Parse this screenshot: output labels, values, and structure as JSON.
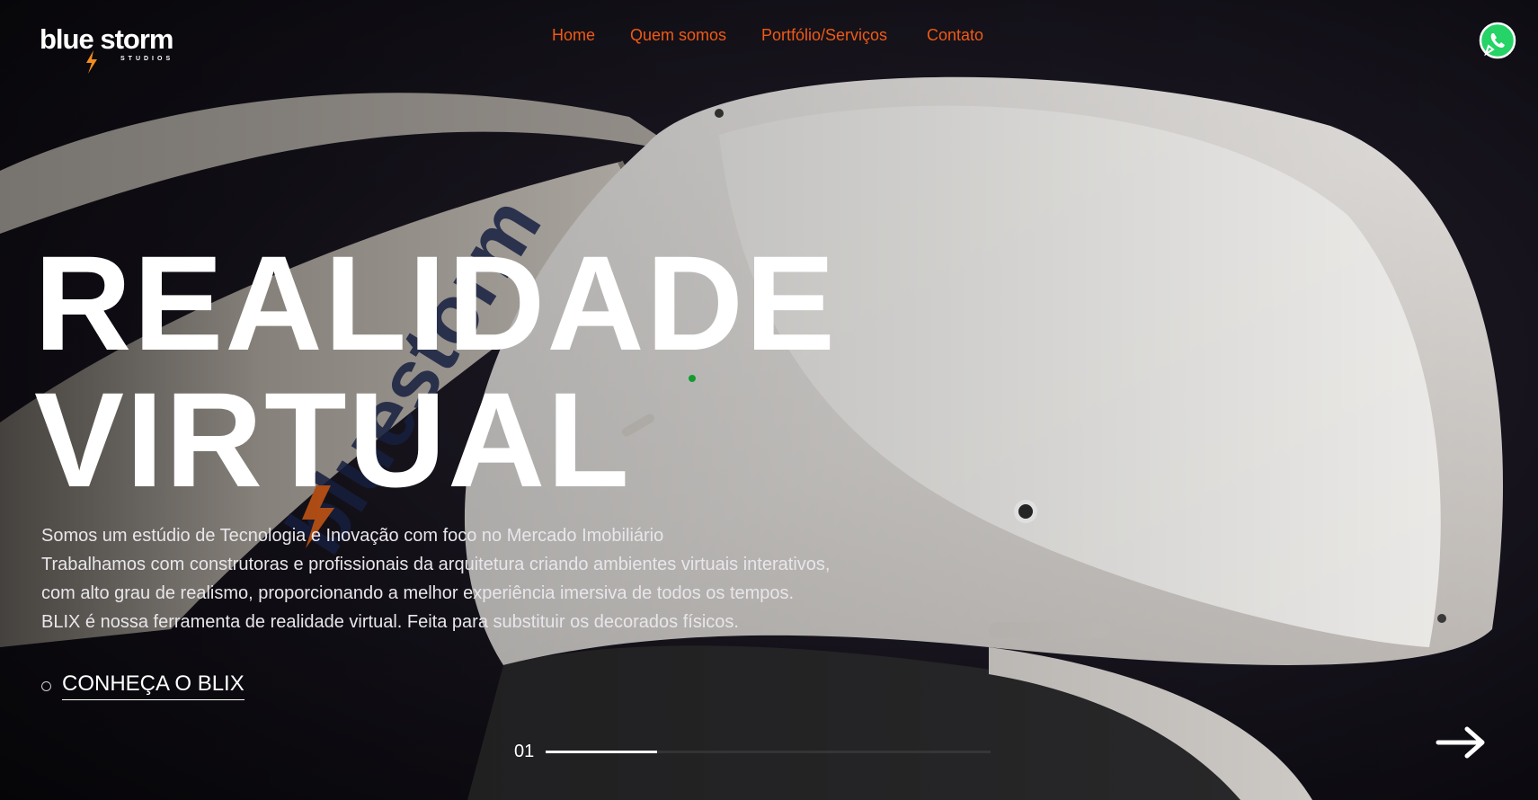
{
  "brand": {
    "name": "blue storm",
    "subtitle": "STUDIOS",
    "accent_color": "#f05a14",
    "logo_blue": "#1aa3e8"
  },
  "nav": {
    "items": [
      {
        "label": "Home"
      },
      {
        "label": "Quem somos"
      },
      {
        "label": "Portfólio/Serviços"
      },
      {
        "label": "Contato"
      }
    ]
  },
  "whatsapp": {
    "icon": "whatsapp-icon",
    "color": "#25d366"
  },
  "hero": {
    "headline_line1": "REALIDADE",
    "headline_line2": "VIRTUAL",
    "description": [
      "Somos um estúdio de Tecnologia e Inovação com foco no Mercado Imobiliário",
      "Trabalhamos com construtoras e profissionais da arquitetura criando ambientes virtuais interativos,",
      "com alto grau de realismo, proporcionando a melhor experiência imersiva de todos os tempos.",
      "BLIX é nossa ferramenta de realidade virtual. Feita para substituir os decorados físicos."
    ],
    "cta_label": "CONHEÇA O BLIX"
  },
  "slider": {
    "current": "01",
    "progress_fraction": 0.25,
    "next_icon": "arrow-right-icon"
  }
}
